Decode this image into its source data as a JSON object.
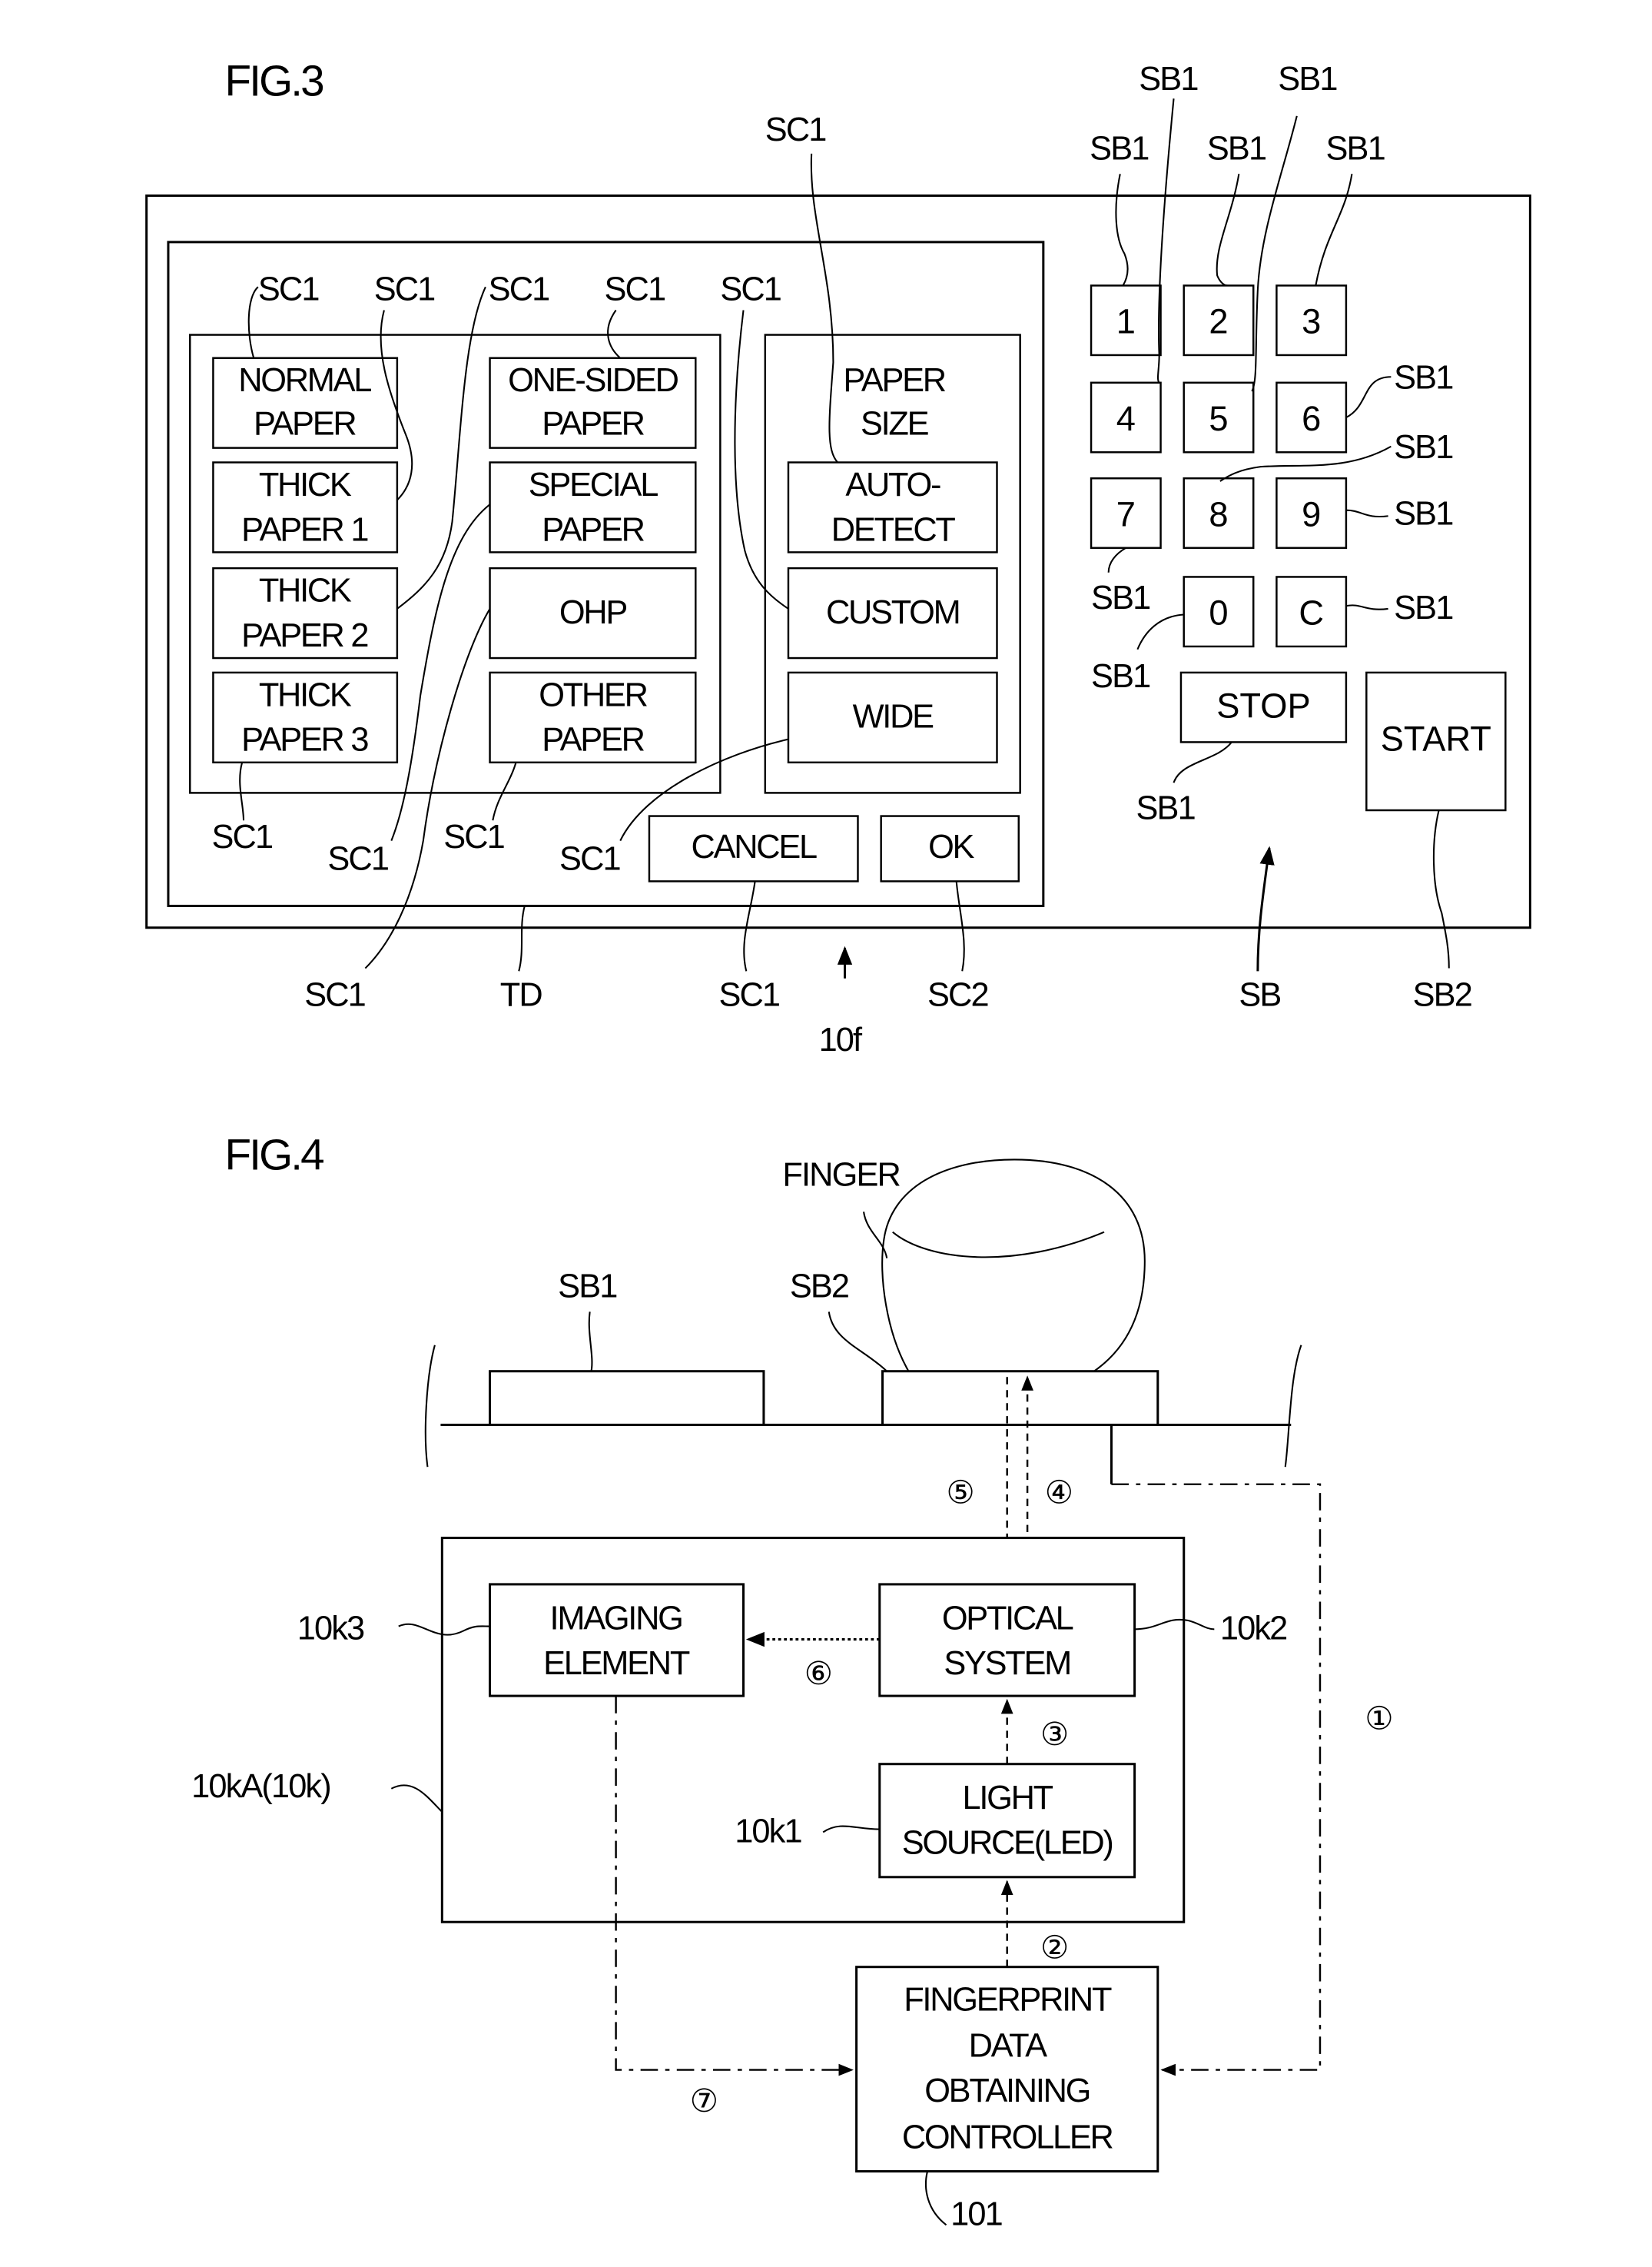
{
  "fig3": {
    "title": "FIG.3",
    "paper_types": [
      [
        "NORMAL",
        "PAPER"
      ],
      [
        "THICK",
        "PAPER 1"
      ],
      [
        "THICK",
        "PAPER 2"
      ],
      [
        "THICK",
        "PAPER 3"
      ],
      [
        "ONE-SIDED",
        "PAPER"
      ],
      [
        "SPECIAL",
        "PAPER"
      ],
      [
        "OHP"
      ],
      [
        "OTHER",
        "PAPER"
      ]
    ],
    "paper_size": {
      "heading": [
        "PAPER",
        "SIZE"
      ],
      "options": [
        [
          "AUTO-",
          "DETECT"
        ],
        [
          "CUSTOM"
        ],
        [
          "WIDE"
        ]
      ]
    },
    "cancel_label": "CANCEL",
    "ok_label": "OK",
    "keypad": [
      "1",
      "2",
      "3",
      "4",
      "5",
      "6",
      "7",
      "8",
      "9",
      "0",
      "C"
    ],
    "stop_label": "STOP",
    "start_label": "START",
    "refs": {
      "sc1": "SC1",
      "sc2": "SC2",
      "sb1": "SB1",
      "sb": "SB",
      "sb2": "SB2",
      "td": "TD",
      "panel": "10f"
    }
  },
  "fig4": {
    "title": "FIG.4",
    "finger_label": "FINGER",
    "sb1": "SB1",
    "sb2": "SB2",
    "imaging": [
      "IMAGING",
      "ELEMENT"
    ],
    "optical": [
      "OPTICAL",
      "SYSTEM"
    ],
    "light": [
      "LIGHT",
      "SOURCE(LED)"
    ],
    "controller": [
      "FINGERPRINT",
      "DATA",
      "OBTAINING",
      "CONTROLLER"
    ],
    "refs": {
      "k3": "10k3",
      "k2": "10k2",
      "k1": "10k1",
      "ka": "10kA(10k)",
      "ctrl": "101"
    },
    "steps": [
      "①",
      "②",
      "③",
      "④",
      "⑤",
      "⑥",
      "⑦"
    ]
  }
}
